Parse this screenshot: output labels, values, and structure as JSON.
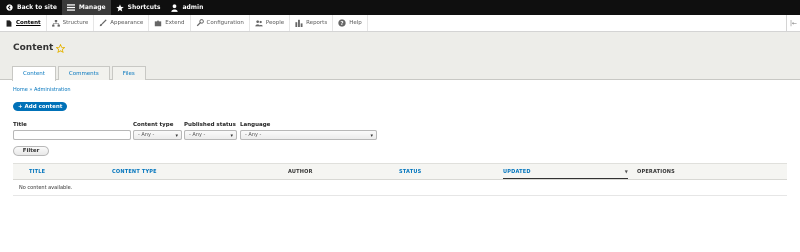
{
  "toolbar": {
    "back_to_site": "Back to site",
    "manage": "Manage",
    "shortcuts": "Shortcuts",
    "user": "admin"
  },
  "tray": {
    "items": [
      {
        "label": "Content",
        "icon": "page-icon"
      },
      {
        "label": "Structure",
        "icon": "sitemap-icon"
      },
      {
        "label": "Appearance",
        "icon": "brush-icon"
      },
      {
        "label": "Extend",
        "icon": "puzzle-icon"
      },
      {
        "label": "Configuration",
        "icon": "wrench-icon"
      },
      {
        "label": "People",
        "icon": "people-icon"
      },
      {
        "label": "Reports",
        "icon": "bar-chart-icon"
      },
      {
        "label": "Help",
        "icon": "help-icon"
      }
    ],
    "collapse": "|←"
  },
  "page": {
    "title": "Content",
    "tabs": [
      "Content",
      "Comments",
      "Files"
    ]
  },
  "breadcrumb": "Home » Administration",
  "add_content": "+ Add content",
  "filters": {
    "title_label": "Title",
    "title_value": "",
    "content_type_label": "Content type",
    "content_type_value": "- Any -",
    "published_label": "Published status",
    "published_value": "- Any -",
    "language_label": "Language",
    "language_value": "- Any -",
    "filter_button": "Filter"
  },
  "table": {
    "headers": [
      "TITLE",
      "CONTENT TYPE",
      "AUTHOR",
      "STATUS",
      "UPDATED",
      "OPERATIONS"
    ],
    "sort_indicator": "▼",
    "empty_message": "No content available."
  },
  "colors": {
    "toolbar_bg": "#0f0f0f",
    "accent": "#0071b8",
    "link": "#0074bd",
    "header_bg": "#edede9"
  }
}
